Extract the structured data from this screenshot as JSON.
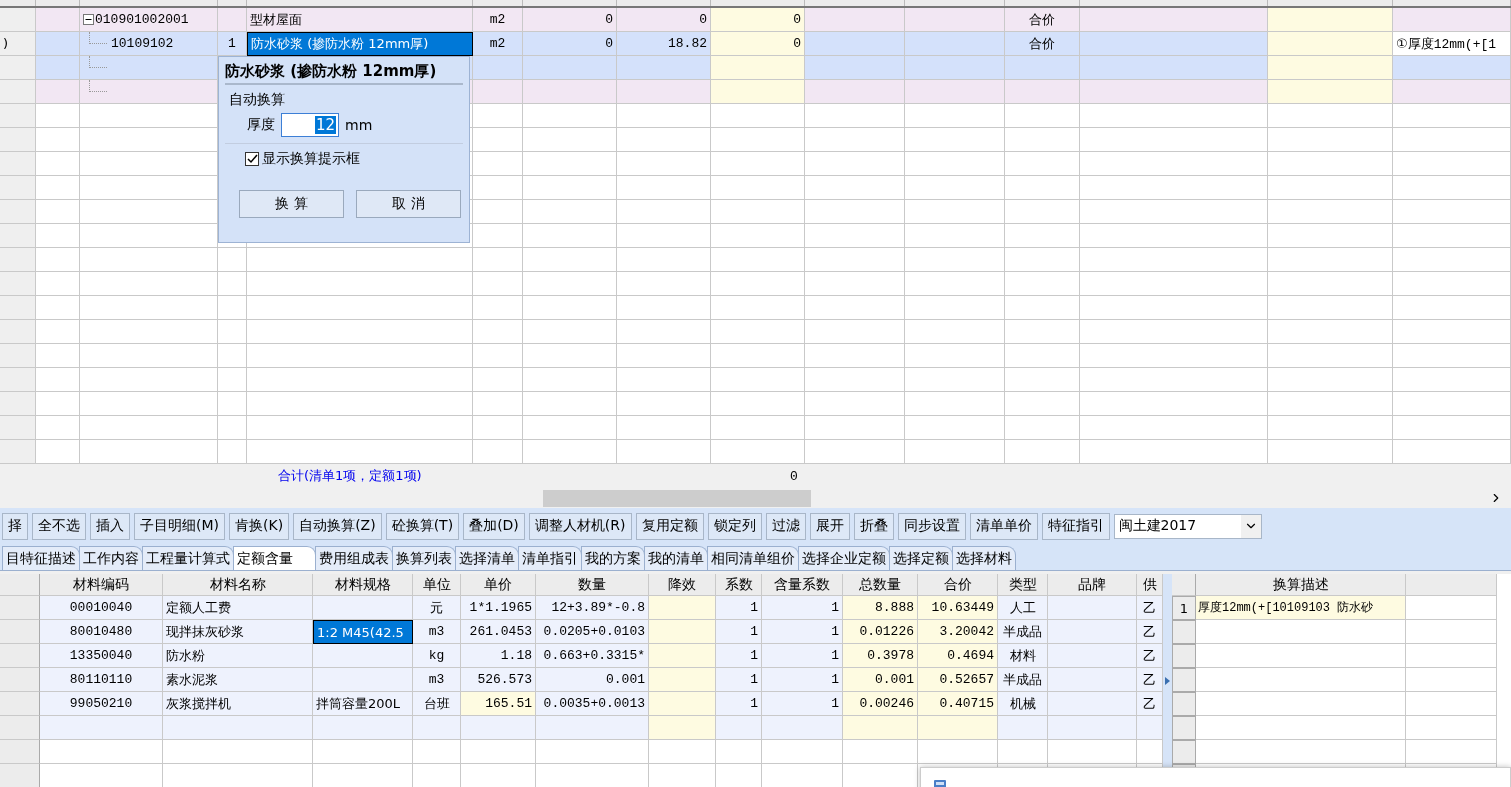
{
  "grid": {
    "rows": [
      {
        "kind": "bill",
        "expanded": true,
        "code": "010901002001",
        "name": "型材屋面",
        "name_selected": false,
        "unit": "m2",
        "quantity": "0",
        "price": "0",
        "total": "0",
        "method": "合价"
      },
      {
        "kind": "quota",
        "row_label": ")",
        "code": "10109102",
        "swap": "1",
        "name": "防水砂浆 (掺防水粉 12mm厚)",
        "name_selected": true,
        "unit": "m2",
        "quantity": "0",
        "price": "18.82",
        "total": "0",
        "method": "合价",
        "extra": "①厚度12mm(+[1"
      },
      {
        "kind": "quota",
        "name_selected": false
      },
      {
        "kind": "bill",
        "name_selected": false
      }
    ],
    "summary": "合计(清单1项，定额1项)",
    "summary_total": "0"
  },
  "popup": {
    "title": "防水砂浆 (掺防水粉 12mm厚)",
    "group": "自动换算",
    "field_label": "厚度",
    "value": "12",
    "unit": "mm",
    "checkbox": {
      "label": "显示换算提示框",
      "checked": true
    },
    "buttons": [
      "换 算",
      "取 消"
    ]
  },
  "toolbar": {
    "buttons": [
      "择",
      "全不选",
      "插入",
      "子目明细(M)",
      "肯换(K)",
      "自动换算(Z)",
      "砼换算(T)",
      "叠加(D)",
      "调整人材机(R)",
      "复用定额",
      "锁定列",
      "过滤",
      "展开",
      "折叠",
      "同步设置",
      "清单单价",
      "特征指引"
    ],
    "select": "闽土建2017"
  },
  "tabs": [
    {
      "label": "目特征描述",
      "selected": false
    },
    {
      "label": "工作内容",
      "selected": false
    },
    {
      "label": "工程量计算式",
      "selected": false
    },
    {
      "label": "定额含量",
      "selected": true
    },
    {
      "label": "费用组成表",
      "selected": false
    },
    {
      "label": "换算列表",
      "selected": false
    },
    {
      "label": "选择清单",
      "selected": false
    },
    {
      "label": "清单指引",
      "selected": false
    },
    {
      "label": "我的方案",
      "selected": false
    },
    {
      "label": "我的清单",
      "selected": false
    },
    {
      "label": "相同清单组价",
      "selected": false
    },
    {
      "label": "选择企业定额",
      "selected": false
    },
    {
      "label": "选择定额",
      "selected": false
    },
    {
      "label": "选择材料",
      "selected": false
    }
  ],
  "materials": {
    "columns": [
      "材料编码",
      "材料名称",
      "材料规格",
      "单位",
      "单价",
      "数量",
      "降效",
      "系数",
      "含量系数",
      "总数量",
      "合价",
      "类型",
      "品牌",
      "供"
    ],
    "rows": [
      {
        "code": "00010040",
        "name": "定额人工费",
        "unit": "元",
        "price": "1*1.1965",
        "qty": "12+3.89*-0.8",
        "factor": "1",
        "content_factor": "1",
        "total_qty": "8.888",
        "amount": "10.63449",
        "type": "人工",
        "supply": "乙",
        "spec_selected": false,
        "price_highlighted": false
      },
      {
        "code": "80010480",
        "name": "现拌抹灰砂浆",
        "spec": "1:2 M45(42.5",
        "unit": "m3",
        "price": "261.0453",
        "qty": "0.0205+0.0103",
        "factor": "1",
        "content_factor": "1",
        "total_qty": "0.01226",
        "amount": "3.20042",
        "type": "半成品",
        "supply": "乙",
        "spec_selected": true,
        "price_highlighted": false
      },
      {
        "code": "13350040",
        "name": "防水粉",
        "unit": "kg",
        "price": "1.18",
        "qty": "0.663+0.3315*",
        "factor": "1",
        "content_factor": "1",
        "total_qty": "0.3978",
        "amount": "0.4694",
        "type": "材料",
        "supply": "乙",
        "spec_selected": false,
        "price_highlighted": false
      },
      {
        "code": "80110110",
        "name": "素水泥浆",
        "unit": "m3",
        "price": "526.573",
        "qty": "0.001",
        "factor": "1",
        "content_factor": "1",
        "total_qty": "0.001",
        "amount": "0.52657",
        "type": "半成品",
        "supply": "乙",
        "spec_selected": false,
        "price_highlighted": false
      },
      {
        "code": "99050210",
        "name": "灰浆搅拌机",
        "spec": "拌筒容量200L",
        "unit": "台班",
        "price": "165.51",
        "qty": "0.0035+0.0013",
        "factor": "1",
        "content_factor": "1",
        "total_qty": "0.00246",
        "amount": "0.40715",
        "type": "机械",
        "supply": "乙",
        "spec_selected": false,
        "price_highlighted": true
      }
    ]
  },
  "conversion": {
    "header": "换算描述",
    "rows": [
      {
        "index": "1",
        "text": "厚度12mm(+[10109103 防水砂"
      }
    ]
  }
}
